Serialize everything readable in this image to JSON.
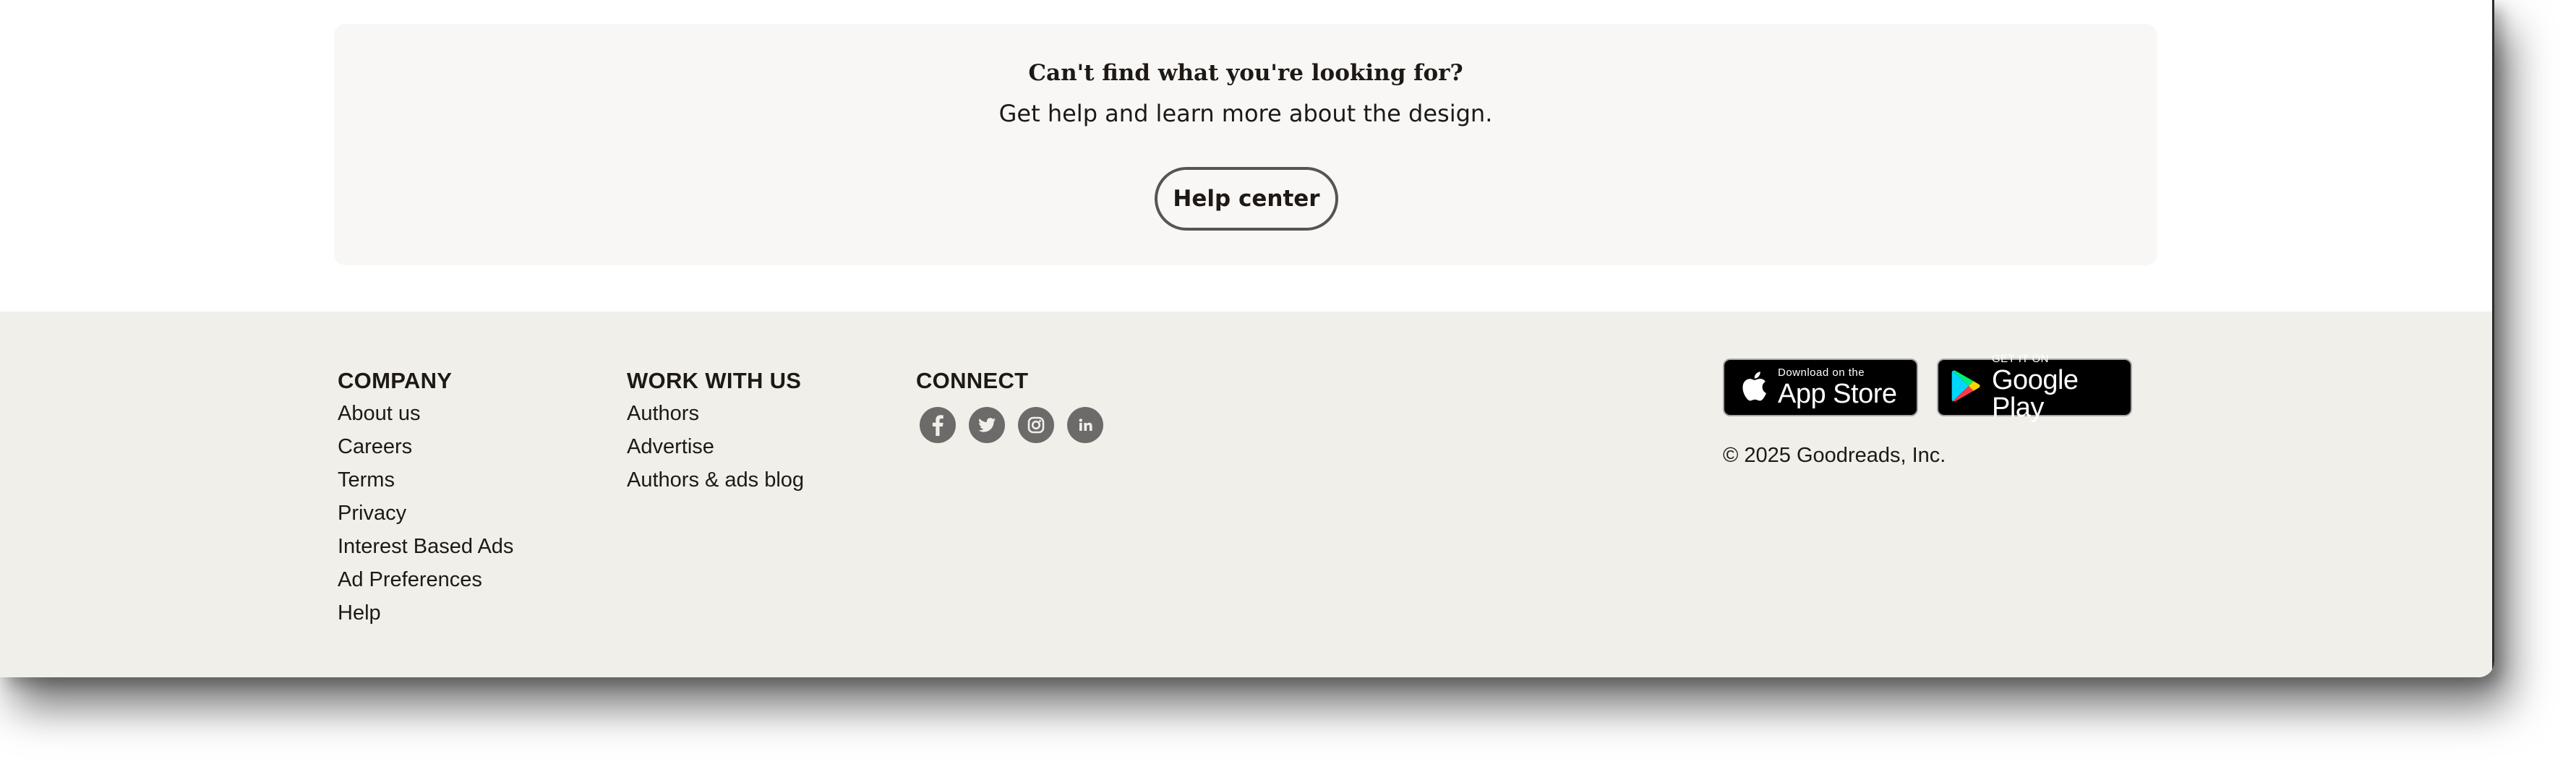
{
  "help": {
    "title": "Can't find what you're looking for?",
    "subtitle": "Get help and learn more about the design.",
    "button": "Help center"
  },
  "footer": {
    "company": {
      "heading": "COMPANY",
      "links": [
        "About us",
        "Careers",
        "Terms",
        "Privacy",
        "Interest Based Ads",
        "Ad Preferences",
        "Help"
      ]
    },
    "work": {
      "heading": "WORK WITH US",
      "links": [
        "Authors",
        "Advertise",
        "Authors & ads blog"
      ]
    },
    "connect": {
      "heading": "CONNECT",
      "icons": [
        "facebook-icon",
        "twitter-icon",
        "instagram-icon",
        "linkedin-icon"
      ]
    },
    "apps": {
      "apple_small": "Download on the",
      "apple_big": "App Store",
      "google_small": "GET IT ON",
      "google_big": "Google Play"
    },
    "copyright": "© 2025 Goodreads, Inc."
  },
  "colors": {
    "footer_bg": "#f1efea",
    "panel_bg": "#f8f7f5",
    "text": "#1e1915",
    "social_icon": "#6c6b69"
  }
}
